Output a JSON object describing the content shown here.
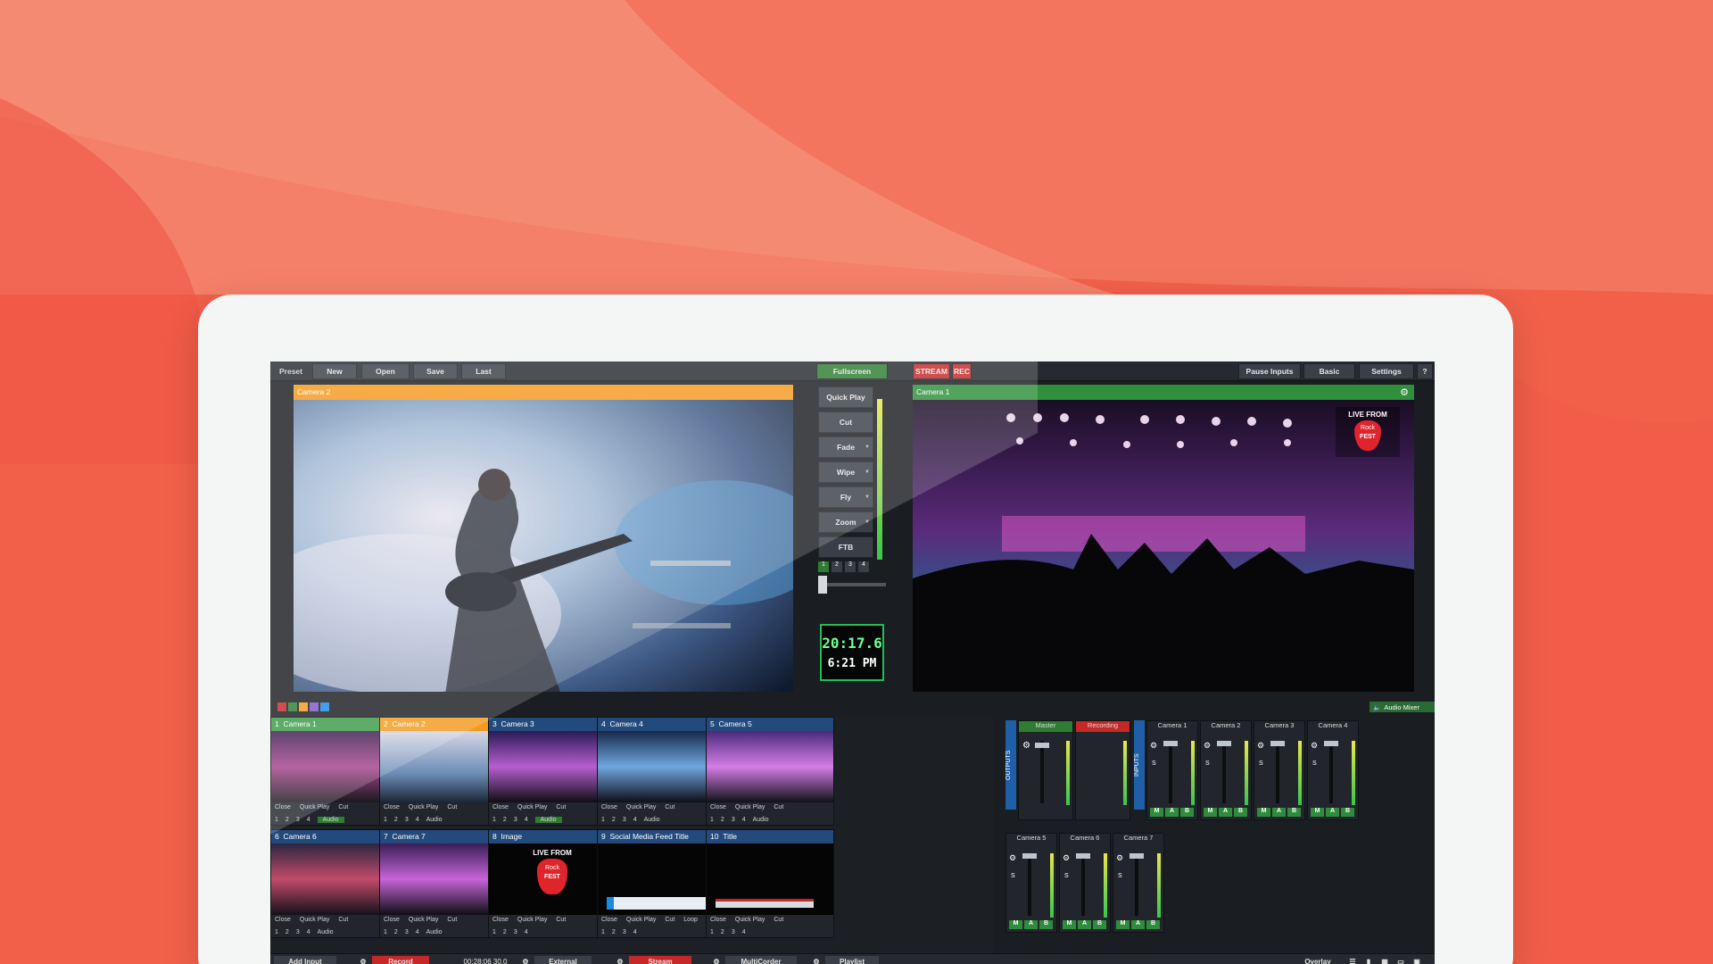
{
  "topbar": {
    "preset": "Preset",
    "new": "New",
    "open": "Open",
    "save": "Save",
    "last": "Last",
    "fullscreen": "Fullscreen",
    "stream": "STREAM",
    "rec": "REC",
    "pause_inputs": "Pause Inputs",
    "basic": "Basic",
    "settings": "Settings",
    "help": "?"
  },
  "preview": {
    "title": "Camera 2"
  },
  "output": {
    "title": "Camera 1",
    "logo_line1": "LIVE FROM",
    "logo_line2": "Rock",
    "logo_line3": "FEST"
  },
  "transitions": [
    "Quick Play",
    "Cut",
    "Fade",
    "Wipe",
    "Fly",
    "Zoom",
    "FTB"
  ],
  "transition_numbers": [
    "1",
    "2",
    "3",
    "4"
  ],
  "clock": {
    "elapsed": "20:17.6",
    "time": "6:21 PM"
  },
  "audio_mixer_label": "Audio Mixer",
  "inputs": [
    {
      "num": "1",
      "name": "Camera 1",
      "color": "#3a9a46"
    },
    {
      "num": "2",
      "name": "Camera 2",
      "color": "#f39a1f"
    },
    {
      "num": "3",
      "name": "Camera 3",
      "color": "#234a7c"
    },
    {
      "num": "4",
      "name": "Camera 4",
      "color": "#234a7c"
    },
    {
      "num": "5",
      "name": "Camera 5",
      "color": "#234a7c"
    },
    {
      "num": "6",
      "name": "Camera 6",
      "color": "#234a7c"
    },
    {
      "num": "7",
      "name": "Camera 7",
      "color": "#234a7c"
    },
    {
      "num": "8",
      "name": "Image",
      "color": "#234a7c"
    },
    {
      "num": "9",
      "name": "Social Media Feed Title",
      "color": "#234a7c"
    },
    {
      "num": "10",
      "name": "Title",
      "color": "#234a7c"
    }
  ],
  "tile_controls": {
    "close": "Close",
    "quick_play": "Quick Play",
    "cut": "Cut",
    "loop": "Loop",
    "audio": "Audio"
  },
  "mixer": {
    "outputs_label": "OUTPUTS",
    "inputs_label": "INPUTS",
    "master": "Master",
    "recording": "Recording",
    "strips": [
      "Camera 1",
      "Camera 2",
      "Camera 3",
      "Camera 4",
      "Camera 5",
      "Camera 6",
      "Camera 7"
    ],
    "m": "M",
    "a": "A",
    "b": "B",
    "s": "S"
  },
  "bottombar": {
    "add_input": "Add Input",
    "record": "Record",
    "record_time": "00:28:06 30.0",
    "external": "External",
    "stream": "Stream",
    "multicorder": "MultiCorder",
    "playlist": "Playlist",
    "overlay": "Overlay"
  }
}
